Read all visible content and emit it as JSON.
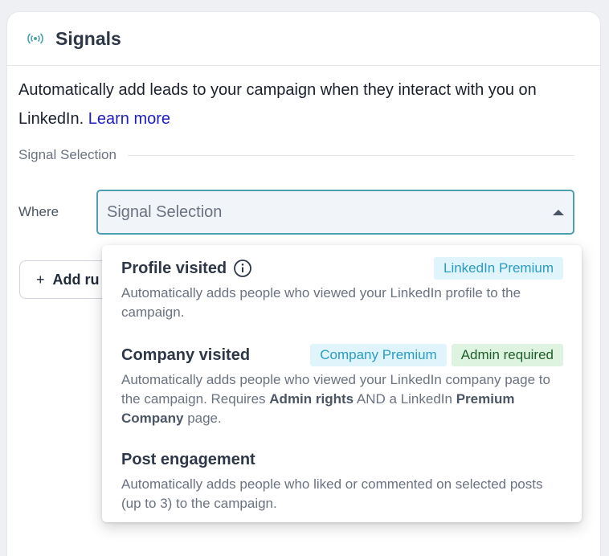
{
  "panel": {
    "title": "Signals",
    "icon": "broadcast-icon",
    "intro": "Automatically add leads to your campaign when they interact with you on LinkedIn.",
    "learn_more": "Learn more"
  },
  "section": {
    "label": "Signal Selection"
  },
  "where": {
    "label": "Where",
    "select_placeholder": "Signal Selection"
  },
  "add_rule": {
    "plus": "+",
    "label": "Add ru"
  },
  "dropdown": {
    "options": [
      {
        "title": "Profile visited",
        "badges": [
          "LinkedIn Premium"
        ],
        "desc": "Automatically adds people who viewed your LinkedIn profile to the campaign."
      },
      {
        "title": "Company visited",
        "badges": [
          "Company Premium",
          "Admin required"
        ],
        "desc_pre": "Automatically adds people who viewed your LinkedIn company page to the campaign. Requires ",
        "desc_bold1": "Admin rights",
        "desc_mid": " AND a LinkedIn ",
        "desc_bold2": "Premium Company",
        "desc_post": " page."
      },
      {
        "title": "Post engagement",
        "badges": [],
        "desc": "Automatically adds people who liked or commented on selected posts (up to 3) to the campaign."
      }
    ]
  },
  "colors": {
    "accent": "#4b9fb0",
    "link": "#1d1dbf",
    "badge_blue_bg": "#e0f4fb",
    "badge_green_bg": "#def4e1"
  }
}
